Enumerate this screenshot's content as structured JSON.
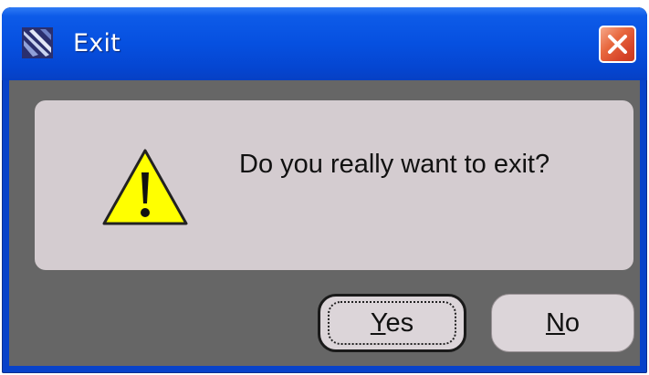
{
  "window": {
    "title": "Exit",
    "app_icon": "java-cup-icon",
    "close_icon": "close-icon"
  },
  "dialog": {
    "message": "Do you really want to exit?",
    "icon": "warning-icon"
  },
  "buttons": {
    "yes": {
      "mnemonic": "Y",
      "rest": "es"
    },
    "no": {
      "mnemonic": "N",
      "rest": "o"
    }
  },
  "colors": {
    "titlebar": "#0650e0",
    "close_button": "#e0552f",
    "client_background": "#666666",
    "panel_background": "#d4ccd0",
    "warning_fill": "#ffff00"
  }
}
